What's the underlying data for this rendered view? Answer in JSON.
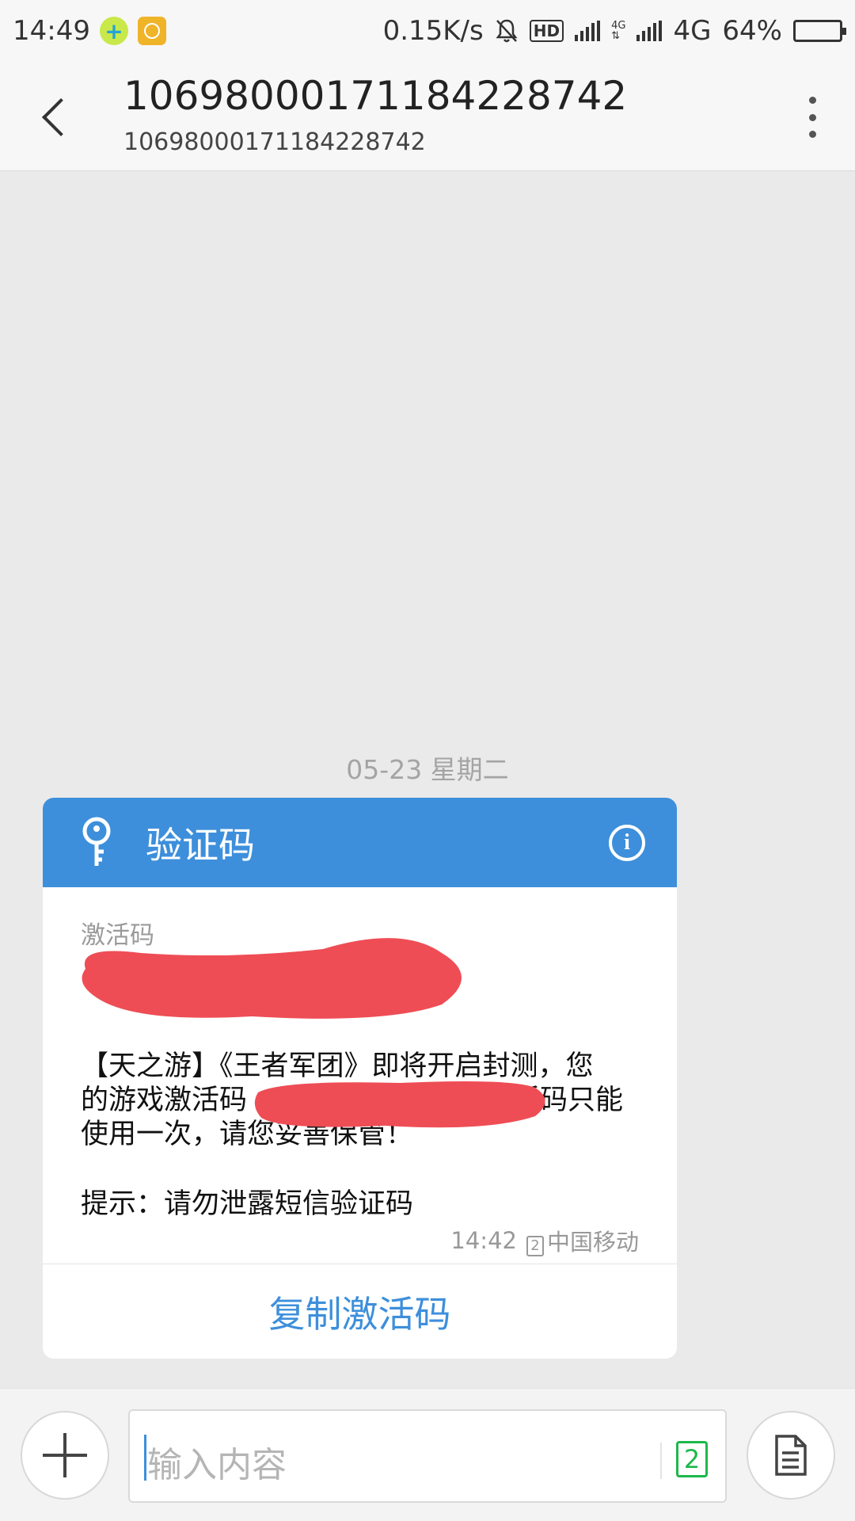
{
  "status_bar": {
    "time": "14:49",
    "net_speed": "0.15K/s",
    "hd": "HD",
    "network": "4G",
    "network_small": "4G",
    "battery": "64%",
    "battery_level": 0.64
  },
  "header": {
    "title": "1069800017118422874​2",
    "subtitle": "10698000171184228742"
  },
  "conversation": {
    "date_separator": "05-23  星期二"
  },
  "card": {
    "title": "验证码",
    "code_label": "激活码",
    "body_line1": "【天之游】《王者军团》即将开启封测，您",
    "body_line2_start": "的游戏激活码",
    "body_line2_end": "激活码只能",
    "body_line3": "使用一次，请您妥善保管！",
    "tip": "提示：请勿泄露短信验证码",
    "time": "14:42",
    "sim": "2",
    "carrier": "中国移动",
    "copy_button": "复制激活码",
    "accent_color": "#3d8fdb",
    "redaction_color": "#ee4d55"
  },
  "composer": {
    "placeholder": "输入内容",
    "sim_selector": "2"
  }
}
